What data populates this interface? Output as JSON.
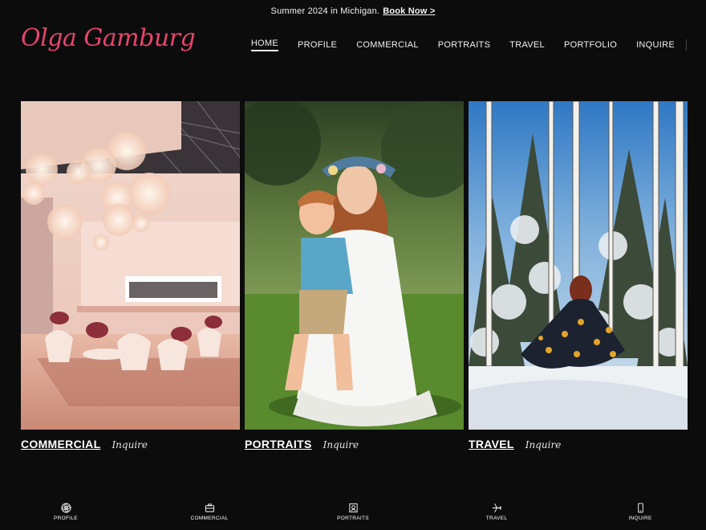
{
  "announcement": {
    "text": "Summer 2024 in Michigan.",
    "link": "Book Now >"
  },
  "logo": {
    "text": "Olga Gamburg"
  },
  "nav": {
    "items": [
      "HOME",
      "PROFILE",
      "COMMERCIAL",
      "PORTRAITS",
      "TRAVEL",
      "PORTFOLIO",
      "INQUIRE"
    ],
    "active": "HOME"
  },
  "gallery": [
    {
      "title": "COMMERCIAL",
      "link": "Inquire",
      "image": "commercial-showroom-photo"
    },
    {
      "title": "PORTRAITS",
      "link": "Inquire",
      "image": "mother-child-portrait-photo"
    },
    {
      "title": "TRAVEL",
      "link": "Inquire",
      "image": "snowy-forest-travel-photo"
    }
  ],
  "bottom_nav": [
    {
      "label": "PROFILE",
      "icon": "aperture-icon"
    },
    {
      "label": "COMMERCIAL",
      "icon": "briefcase-icon"
    },
    {
      "label": "PORTRAITS",
      "icon": "portrait-icon"
    },
    {
      "label": "TRAVEL",
      "icon": "airplane-icon"
    },
    {
      "label": "INQUIRE",
      "icon": "phone-icon"
    }
  ],
  "colors": {
    "background": "#0c0c0d",
    "logo": "#e6456b",
    "text": "#ffffff"
  }
}
